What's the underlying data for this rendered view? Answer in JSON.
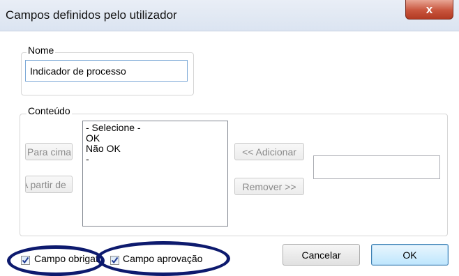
{
  "window": {
    "title": "Campos definidos pelo utilizador",
    "close_glyph": "x"
  },
  "name_group": {
    "legend": "Nome",
    "value": "Indicador de processo"
  },
  "content_group": {
    "legend": "Conteúdo",
    "move_up_label": "Para cima",
    "move_down_label": "A partir de",
    "list_items": [
      "- Selecione -",
      "OK",
      "Não OK",
      "-"
    ],
    "add_label": "<< Adicionar",
    "remove_label": "Remover >>",
    "new_value": ""
  },
  "footer": {
    "mandatory_label": "Campo obrigatório",
    "mandatory_checked": true,
    "approval_label": "Campo aprovação",
    "approval_checked": true,
    "cancel_label": "Cancelar",
    "ok_label": "OK"
  },
  "colors": {
    "highlight_ring": "#0d1a6e",
    "close_button": "#c8553d"
  }
}
